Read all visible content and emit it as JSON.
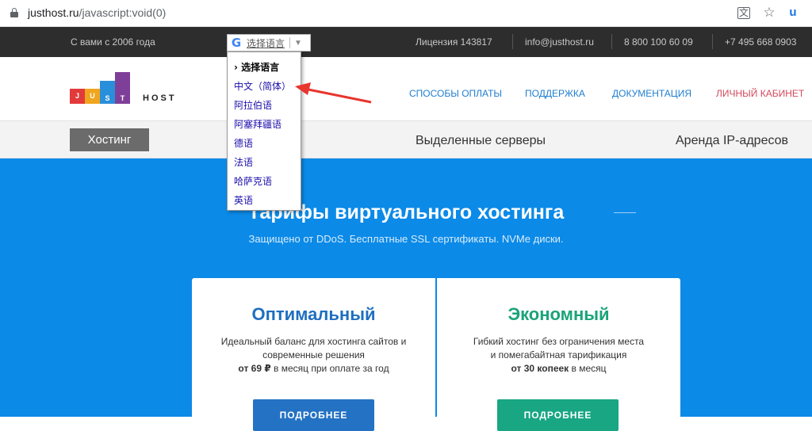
{
  "browser": {
    "url_host": "justhost.ru",
    "url_path": "/javascript:void(0)",
    "icons": [
      "lock-icon",
      "translate-icon",
      "star-icon",
      "extension-icon"
    ]
  },
  "topbar": {
    "since": "С вами с 2006 года",
    "license": "Лицензия 143817",
    "email": "info@justhost.ru",
    "phone1": "8 800 100 60 09",
    "phone2": "+7 495 668 0903"
  },
  "translate": {
    "label": "选择语言",
    "options": [
      "› 选择语言",
      "中文（简体）",
      "阿拉伯语",
      "阿塞拜疆语",
      "德语",
      "法语",
      "哈萨克语",
      "英语"
    ]
  },
  "header": {
    "logo_letters": [
      "J",
      "U",
      "S",
      "T"
    ],
    "logo_host": "HOST",
    "nav": [
      "СПОСОБЫ ОПЛАТЫ",
      "ПОДДЕРЖКА",
      "ДОКУМЕНТАЦИЯ",
      "ЛИЧНЫЙ КАБИНЕТ"
    ]
  },
  "tabs": {
    "active": "Хостинг",
    "items": [
      "Выделенные серверы",
      "Аренда IP-адресов"
    ]
  },
  "hero": {
    "title": "Тарифы виртуального хостинга",
    "subtitle": "Защищено от DDoS. Бесплатные SSL сертификаты. NVMe диски."
  },
  "plans": [
    {
      "name": "Оптимальный",
      "desc_line1": "Идеальный баланс для хостинга сайтов и",
      "desc_line2": "современные решения",
      "price_bold": "от 69 ₽",
      "price_rest": " в месяц при оплате за год",
      "button": "ПОДРОБНЕЕ"
    },
    {
      "name": "Экономный",
      "desc_line1": "Гибкий хостинг без ограничения места",
      "desc_line2": "и помегабайтная тарификация",
      "price_bold": "от 30 копеек",
      "price_rest": " в месяц",
      "button": "ПОДРОБНЕЕ"
    }
  ],
  "colors": {
    "hero_bg": "#0b8ae8",
    "optimal": "#1e6fbf",
    "economy": "#1aa37a",
    "nav_link": "#1e7dd0",
    "account_link": "#d04a5c",
    "annotation_arrow": "#e8352e"
  }
}
